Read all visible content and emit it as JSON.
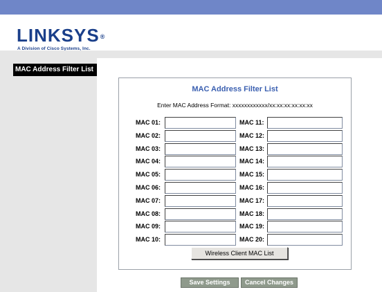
{
  "header": {
    "logo_text": "LINKSYS",
    "logo_reg": "®",
    "logo_subtitle": "A Division of Cisco Systems, Inc."
  },
  "sidebar": {
    "tab_label": "MAC Address Filter List"
  },
  "panel": {
    "title": "MAC Address Filter List",
    "format_text": "Enter MAC Address Format: xxxxxxxxxxxx/xx:xx:xx:xx:xx:xx",
    "rows": [
      {
        "left_label": "MAC 01:",
        "left_value": "",
        "right_label": "MAC 11:",
        "right_value": ""
      },
      {
        "left_label": "MAC 02:",
        "left_value": "",
        "right_label": "MAC 12:",
        "right_value": ""
      },
      {
        "left_label": "MAC 03:",
        "left_value": "",
        "right_label": "MAC 13:",
        "right_value": ""
      },
      {
        "left_label": "MAC 04:",
        "left_value": "",
        "right_label": "MAC 14:",
        "right_value": ""
      },
      {
        "left_label": "MAC 05:",
        "left_value": "",
        "right_label": "MAC 15:",
        "right_value": ""
      },
      {
        "left_label": "MAC 06:",
        "left_value": "",
        "right_label": "MAC 16:",
        "right_value": ""
      },
      {
        "left_label": "MAC 07:",
        "left_value": "",
        "right_label": "MAC 17:",
        "right_value": ""
      },
      {
        "left_label": "MAC 08:",
        "left_value": "",
        "right_label": "MAC 18:",
        "right_value": ""
      },
      {
        "left_label": "MAC 09:",
        "left_value": "",
        "right_label": "MAC 19:",
        "right_value": ""
      },
      {
        "left_label": "MAC 10:",
        "left_value": "",
        "right_label": "MAC 20:",
        "right_value": ""
      }
    ],
    "wireless_button_label": "Wireless Client MAC List"
  },
  "footer": {
    "save_label": "Save Settings",
    "cancel_label": "Cancel Changes"
  },
  "colors": {
    "top_bar": "#6f86c8",
    "brand": "#1a3f8a",
    "title": "#3a5fb0",
    "sidebar_bg": "#e6e6e6",
    "footer_button": "#8f9a8c"
  }
}
